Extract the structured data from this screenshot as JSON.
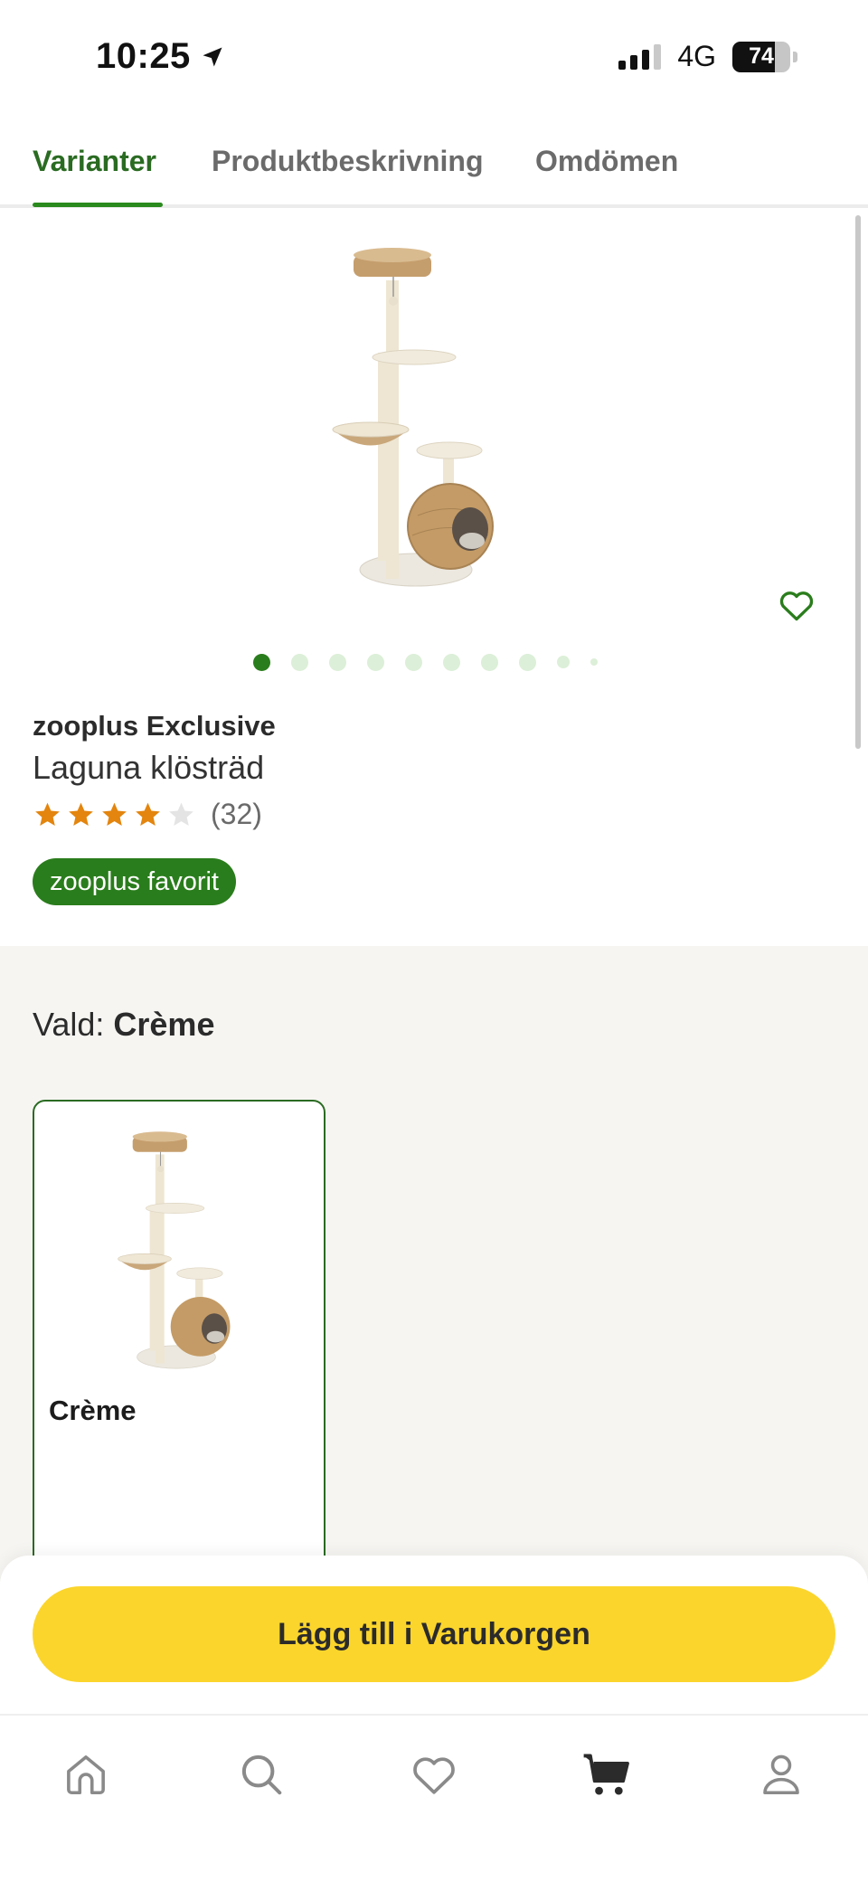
{
  "status_bar": {
    "time": "10:25",
    "network": "4G",
    "battery": "74",
    "battery_level": 0.74
  },
  "tabs": [
    {
      "label": "Varianter",
      "active": true
    },
    {
      "label": "Produktbeskrivning",
      "active": false
    },
    {
      "label": "Omdömen",
      "active": false
    }
  ],
  "gallery": {
    "image_icon": "cat-tree-image",
    "dot_count": 10,
    "active_dot": 0
  },
  "product": {
    "brand": "zooplus Exclusive",
    "name": "Laguna klösträd",
    "rating": 4,
    "rating_max": 5,
    "review_count": "(32)",
    "badge": "zooplus favorit"
  },
  "variants": {
    "selected_prefix": "Vald:",
    "selected_value": "Crème",
    "items": [
      {
        "name": "Crème",
        "selected": true
      }
    ]
  },
  "cart": {
    "button_label": "Lägg till i Varukorgen"
  },
  "bottom_nav": [
    {
      "icon": "home-icon",
      "active": false
    },
    {
      "icon": "search-icon",
      "active": false
    },
    {
      "icon": "heart-icon",
      "active": false
    },
    {
      "icon": "cart-icon",
      "active": true
    },
    {
      "icon": "profile-icon",
      "active": false
    }
  ],
  "colors": {
    "primary_green": "#2a7d1c",
    "cta_yellow": "#fbd52c",
    "star_orange": "#e3850e",
    "section_bg": "#f6f5f2"
  }
}
